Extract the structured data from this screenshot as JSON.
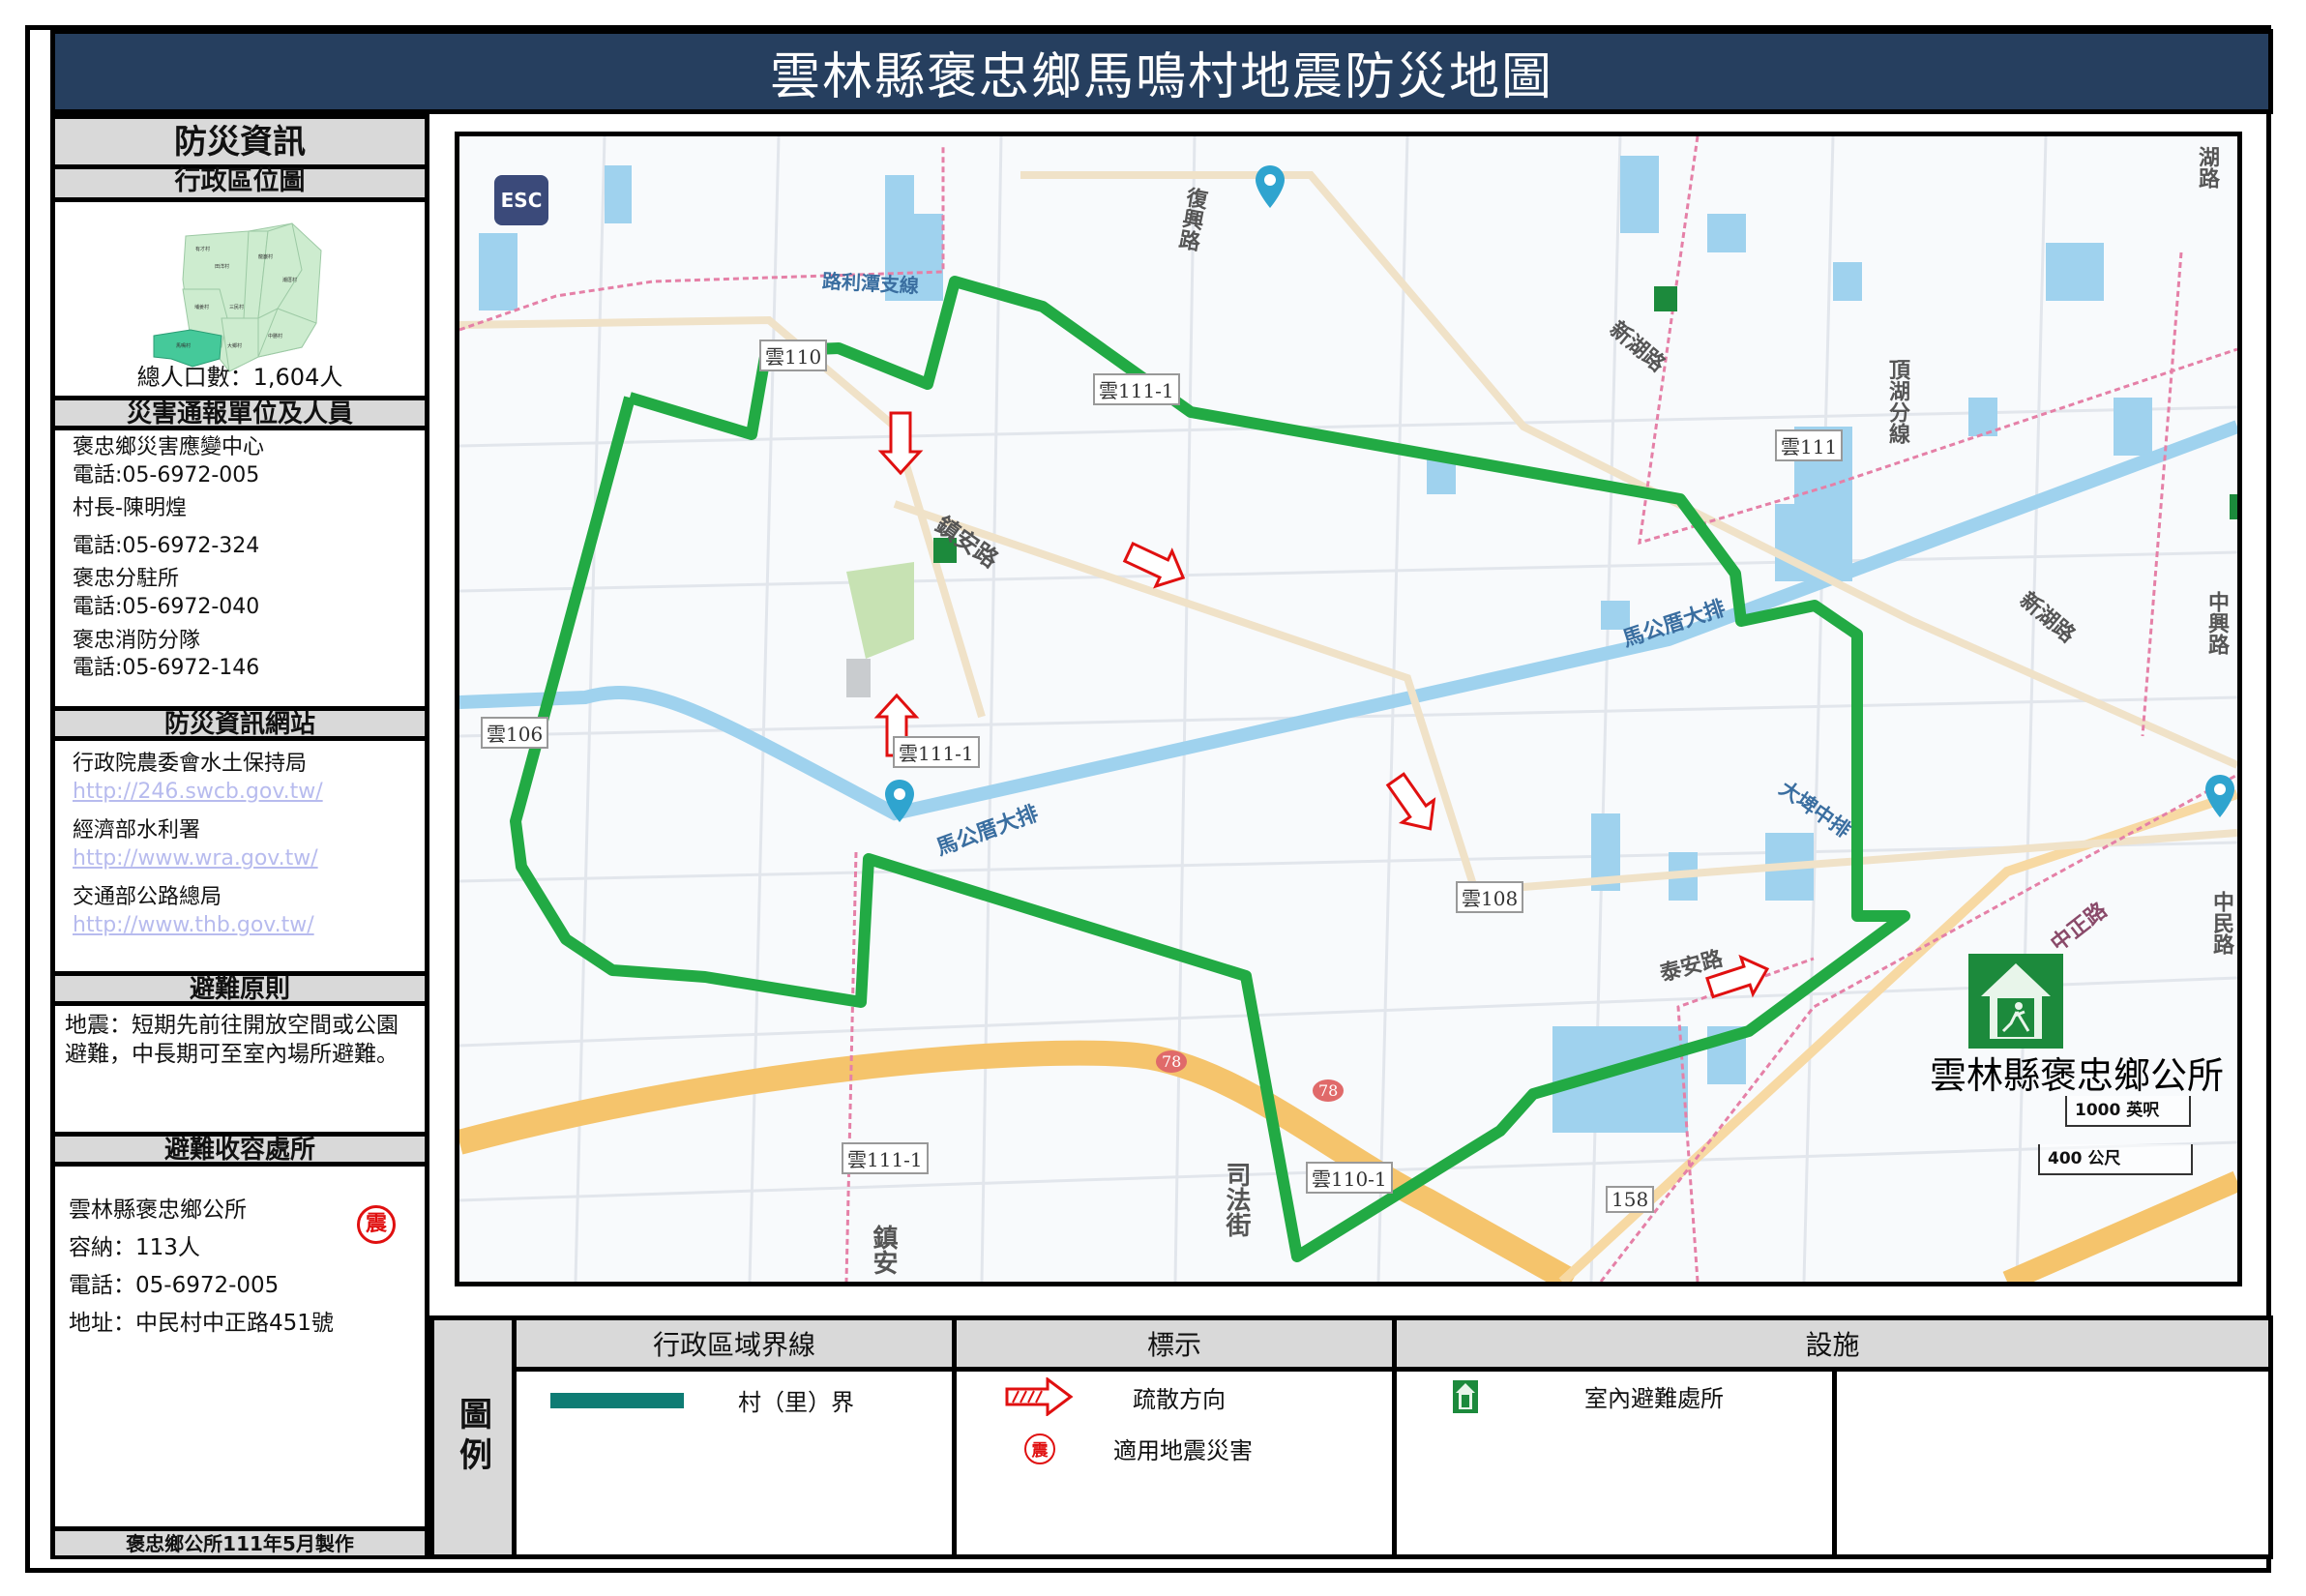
{
  "title": "雲林縣褒忠鄉馬鳴村地震防災地圖",
  "left_panel": {
    "disaster_info_heading": "防災資訊",
    "admin_location_heading": "行政區位圖",
    "population_label": "總人口數：1,604人",
    "minimap_villages": [
      "馬鳴村",
      "埔姜村",
      "三民村",
      "新湖村",
      "龍巖村",
      "潮厝村",
      "中勝村",
      "大鄉村",
      "有才村",
      "田洋村"
    ],
    "report_heading": "災害通報單位及人員",
    "contacts": [
      {
        "name": "褒忠鄉災害應變中心",
        "phone": "電話:05-6972-005"
      },
      {
        "name": "村長-陳明煌",
        "phone": "電話:05-6972-324"
      },
      {
        "name": "褒忠分駐所",
        "phone": "電話:05-6972-040"
      },
      {
        "name": "褒忠消防分隊",
        "phone": "電話:05-6972-146"
      }
    ],
    "websites_heading": "防災資訊網站",
    "websites": [
      {
        "name": "行政院農委會水土保持局",
        "url": "http://246.swcb.gov.tw/"
      },
      {
        "name": "經濟部水利署",
        "url": "http://www.wra.gov.tw/"
      },
      {
        "name": "交通部公路總局",
        "url": "http://www.thb.gov.tw/"
      }
    ],
    "principle_heading": "避難原則",
    "principle_text": "地震：短期先前往開放空間或公園避難，中長期可至室內場所避難。",
    "shelter_heading": "避難收容處所",
    "shelter": {
      "name": "雲林縣褒忠鄉公所",
      "capacity": "容納：113人",
      "phone": "電話：05-6972-005",
      "address": "地址：中民村中正路451號",
      "badge": "震"
    },
    "credit": "褒忠鄉公所111年5月製作"
  },
  "map": {
    "esc_button": "ESC",
    "boundary_color": "#22aa44",
    "road_labels": [
      {
        "text": "路利潭支線"
      },
      {
        "text": "復興路"
      },
      {
        "text": "新湖路"
      },
      {
        "text": "頂湖分線"
      },
      {
        "text": "鎮安路"
      },
      {
        "text": "馬公厝大排"
      },
      {
        "text": "馬公厝大排"
      },
      {
        "text": "新湖路"
      },
      {
        "text": "中興路"
      },
      {
        "text": "大埤中排"
      },
      {
        "text": "泰安路"
      },
      {
        "text": "中正路"
      },
      {
        "text": "中民路"
      },
      {
        "text": "司法街"
      },
      {
        "text": "鎮安"
      },
      {
        "text": "湖路"
      }
    ],
    "route_shields": [
      "雲110",
      "雲111-1",
      "雲111",
      "雲106",
      "雲111-1",
      "雲108",
      "雲111-1",
      "雲110-1",
      "158",
      "78",
      "78"
    ],
    "shelter_label": "雲林縣褒忠鄉公所",
    "scale_ft": "1000 英呎",
    "scale_m": "400 公尺"
  },
  "legend": {
    "title": "圖例",
    "col_admin": "行政區域界線",
    "col_marks": "標示",
    "col_facilities": "設施",
    "village_boundary": "村（里）界",
    "village_boundary_color": "#0e7c74",
    "evac_direction": "疏散方向",
    "earthquake_applicable": "適用地震災害",
    "indoor_shelter": "室內避難處所",
    "eq_badge": "震"
  }
}
